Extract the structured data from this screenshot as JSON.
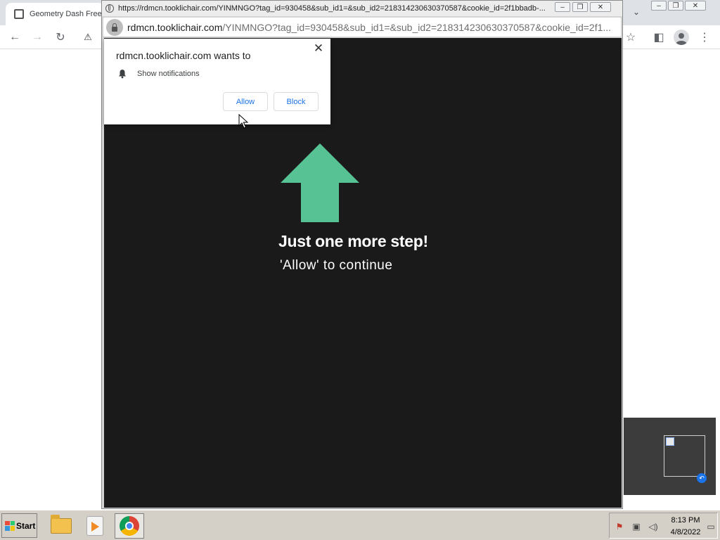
{
  "background_browser": {
    "tab_title": "Geometry Dash Free",
    "toolbar_icons": [
      "back-icon",
      "forward-icon",
      "reload-icon",
      "warning-icon",
      "star-icon",
      "sidebar-icon",
      "profile-icon",
      "menu-icon"
    ]
  },
  "popup": {
    "title_url": "https://rdmcn.tooklichair.com/YINMNGO?tag_id=930458&sub_id1=&sub_id2=218314230630370587&cookie_id=2f1bbadb-...",
    "address_host": "rdmcn.tooklichair.com",
    "address_path": "/YINMNGO?tag_id=930458&sub_id1=&sub_id2=218314230630370587&cookie_id=2f1...",
    "headline": "Just one more step!",
    "subline": "'Allow' to continue",
    "arrow_color": "#57c293",
    "background_color": "#1a1a1a"
  },
  "notification": {
    "title": "rdmcn.tooklichair.com wants to",
    "permission": "Show notifications",
    "allow_label": "Allow",
    "block_label": "Block",
    "close_glyph": "✕"
  },
  "taskbar": {
    "start_label": "Start",
    "apps": [
      "folder-icon",
      "media-player-icon",
      "chrome-icon"
    ],
    "active_app": "chrome-icon",
    "time": "8:13 PM",
    "date": "4/8/2022"
  }
}
